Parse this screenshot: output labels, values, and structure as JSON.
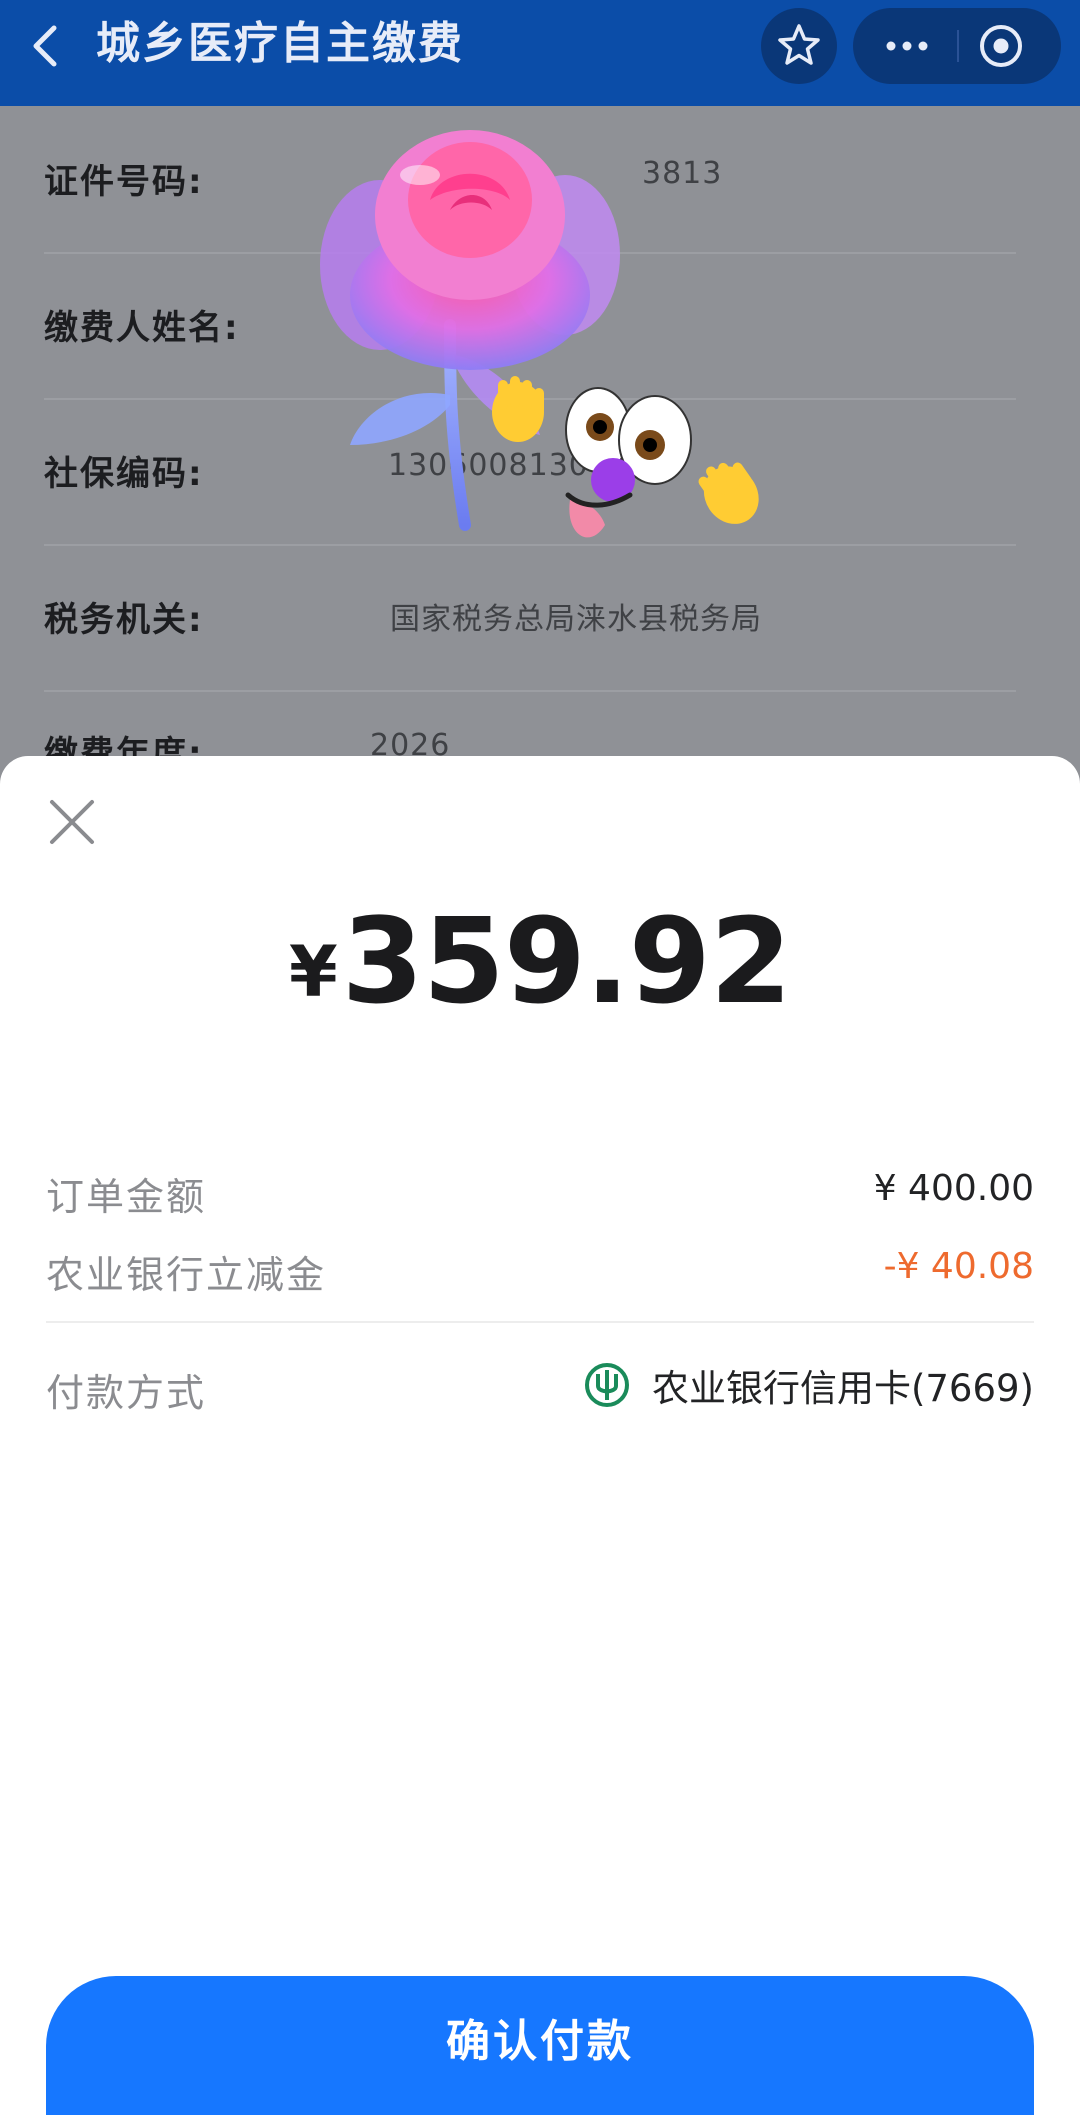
{
  "header": {
    "title": "城乡医疗自主缴费"
  },
  "form": {
    "rows": [
      {
        "label": "证件号码:",
        "value": "3813"
      },
      {
        "label": "缴费人姓名:",
        "value": ""
      },
      {
        "label": "社保编码:",
        "value": "13060081306293"
      },
      {
        "label": "税务机关:",
        "value": "国家税务总局涞水县税务局"
      },
      {
        "label": "缴费年度:",
        "value": "2026"
      }
    ]
  },
  "sheet": {
    "currency_symbol": "¥",
    "amount": "359.92",
    "order_amount_label": "订单金额",
    "order_amount_value": "¥ 400.00",
    "discount_label": "农业银行立减金",
    "discount_value": "-¥ 40.08",
    "payment_method_label": "付款方式",
    "payment_method_value": "农业银行信用卡(7669)",
    "confirm_label": "确认付款"
  },
  "colors": {
    "header_bg": "#0b4da8",
    "primary_button": "#1677ff",
    "discount": "#ee6a2e",
    "bank_icon": "#1a8b5a"
  },
  "icons": {
    "back": "chevron-left-icon",
    "favorite": "star-icon",
    "more": "more-dots-icon",
    "close_mini": "target-circle-icon",
    "close": "close-icon",
    "bank": "abc-bank-icon",
    "sticker": "rose-and-face-sticker"
  }
}
